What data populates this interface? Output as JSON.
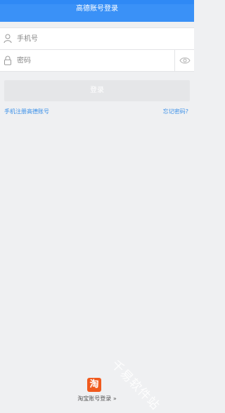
{
  "header": {
    "title": "高德账号登录"
  },
  "form": {
    "phone_placeholder": "手机号",
    "password_placeholder": "密码",
    "login_label": "登录"
  },
  "links": {
    "register": "手机注册高德账号",
    "forgot": "忘记密码?"
  },
  "footer": {
    "taobao_logo_char": "淘",
    "taobao_login": "淘宝账号登录 »"
  },
  "watermark": "千易软件站",
  "colors": {
    "accent": "#3a91f7",
    "link": "#3a8fe8",
    "taobao": "#f05a1e",
    "background": "#eff0f2"
  },
  "icons": [
    "user-icon",
    "lock-icon",
    "eye-icon"
  ]
}
